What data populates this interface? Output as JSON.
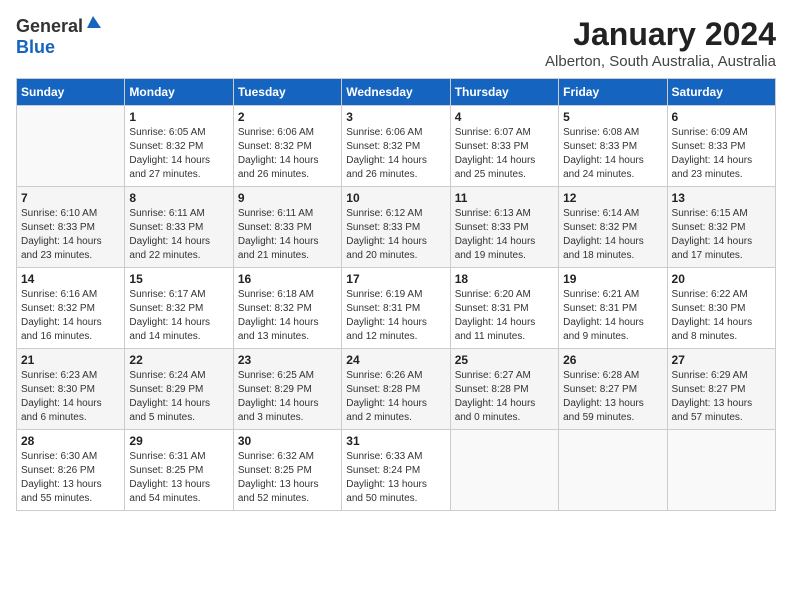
{
  "logo": {
    "general": "General",
    "blue": "Blue"
  },
  "title": "January 2024",
  "location": "Alberton, South Australia, Australia",
  "weekdays": [
    "Sunday",
    "Monday",
    "Tuesday",
    "Wednesday",
    "Thursday",
    "Friday",
    "Saturday"
  ],
  "weeks": [
    [
      {
        "day": "",
        "sunrise": "",
        "sunset": "",
        "daylight": ""
      },
      {
        "day": "1",
        "sunrise": "Sunrise: 6:05 AM",
        "sunset": "Sunset: 8:32 PM",
        "daylight": "Daylight: 14 hours and 27 minutes."
      },
      {
        "day": "2",
        "sunrise": "Sunrise: 6:06 AM",
        "sunset": "Sunset: 8:32 PM",
        "daylight": "Daylight: 14 hours and 26 minutes."
      },
      {
        "day": "3",
        "sunrise": "Sunrise: 6:06 AM",
        "sunset": "Sunset: 8:32 PM",
        "daylight": "Daylight: 14 hours and 26 minutes."
      },
      {
        "day": "4",
        "sunrise": "Sunrise: 6:07 AM",
        "sunset": "Sunset: 8:33 PM",
        "daylight": "Daylight: 14 hours and 25 minutes."
      },
      {
        "day": "5",
        "sunrise": "Sunrise: 6:08 AM",
        "sunset": "Sunset: 8:33 PM",
        "daylight": "Daylight: 14 hours and 24 minutes."
      },
      {
        "day": "6",
        "sunrise": "Sunrise: 6:09 AM",
        "sunset": "Sunset: 8:33 PM",
        "daylight": "Daylight: 14 hours and 23 minutes."
      }
    ],
    [
      {
        "day": "7",
        "sunrise": "Sunrise: 6:10 AM",
        "sunset": "Sunset: 8:33 PM",
        "daylight": "Daylight: 14 hours and 23 minutes."
      },
      {
        "day": "8",
        "sunrise": "Sunrise: 6:11 AM",
        "sunset": "Sunset: 8:33 PM",
        "daylight": "Daylight: 14 hours and 22 minutes."
      },
      {
        "day": "9",
        "sunrise": "Sunrise: 6:11 AM",
        "sunset": "Sunset: 8:33 PM",
        "daylight": "Daylight: 14 hours and 21 minutes."
      },
      {
        "day": "10",
        "sunrise": "Sunrise: 6:12 AM",
        "sunset": "Sunset: 8:33 PM",
        "daylight": "Daylight: 14 hours and 20 minutes."
      },
      {
        "day": "11",
        "sunrise": "Sunrise: 6:13 AM",
        "sunset": "Sunset: 8:33 PM",
        "daylight": "Daylight: 14 hours and 19 minutes."
      },
      {
        "day": "12",
        "sunrise": "Sunrise: 6:14 AM",
        "sunset": "Sunset: 8:32 PM",
        "daylight": "Daylight: 14 hours and 18 minutes."
      },
      {
        "day": "13",
        "sunrise": "Sunrise: 6:15 AM",
        "sunset": "Sunset: 8:32 PM",
        "daylight": "Daylight: 14 hours and 17 minutes."
      }
    ],
    [
      {
        "day": "14",
        "sunrise": "Sunrise: 6:16 AM",
        "sunset": "Sunset: 8:32 PM",
        "daylight": "Daylight: 14 hours and 16 minutes."
      },
      {
        "day": "15",
        "sunrise": "Sunrise: 6:17 AM",
        "sunset": "Sunset: 8:32 PM",
        "daylight": "Daylight: 14 hours and 14 minutes."
      },
      {
        "day": "16",
        "sunrise": "Sunrise: 6:18 AM",
        "sunset": "Sunset: 8:32 PM",
        "daylight": "Daylight: 14 hours and 13 minutes."
      },
      {
        "day": "17",
        "sunrise": "Sunrise: 6:19 AM",
        "sunset": "Sunset: 8:31 PM",
        "daylight": "Daylight: 14 hours and 12 minutes."
      },
      {
        "day": "18",
        "sunrise": "Sunrise: 6:20 AM",
        "sunset": "Sunset: 8:31 PM",
        "daylight": "Daylight: 14 hours and 11 minutes."
      },
      {
        "day": "19",
        "sunrise": "Sunrise: 6:21 AM",
        "sunset": "Sunset: 8:31 PM",
        "daylight": "Daylight: 14 hours and 9 minutes."
      },
      {
        "day": "20",
        "sunrise": "Sunrise: 6:22 AM",
        "sunset": "Sunset: 8:30 PM",
        "daylight": "Daylight: 14 hours and 8 minutes."
      }
    ],
    [
      {
        "day": "21",
        "sunrise": "Sunrise: 6:23 AM",
        "sunset": "Sunset: 8:30 PM",
        "daylight": "Daylight: 14 hours and 6 minutes."
      },
      {
        "day": "22",
        "sunrise": "Sunrise: 6:24 AM",
        "sunset": "Sunset: 8:29 PM",
        "daylight": "Daylight: 14 hours and 5 minutes."
      },
      {
        "day": "23",
        "sunrise": "Sunrise: 6:25 AM",
        "sunset": "Sunset: 8:29 PM",
        "daylight": "Daylight: 14 hours and 3 minutes."
      },
      {
        "day": "24",
        "sunrise": "Sunrise: 6:26 AM",
        "sunset": "Sunset: 8:28 PM",
        "daylight": "Daylight: 14 hours and 2 minutes."
      },
      {
        "day": "25",
        "sunrise": "Sunrise: 6:27 AM",
        "sunset": "Sunset: 8:28 PM",
        "daylight": "Daylight: 14 hours and 0 minutes."
      },
      {
        "day": "26",
        "sunrise": "Sunrise: 6:28 AM",
        "sunset": "Sunset: 8:27 PM",
        "daylight": "Daylight: 13 hours and 59 minutes."
      },
      {
        "day": "27",
        "sunrise": "Sunrise: 6:29 AM",
        "sunset": "Sunset: 8:27 PM",
        "daylight": "Daylight: 13 hours and 57 minutes."
      }
    ],
    [
      {
        "day": "28",
        "sunrise": "Sunrise: 6:30 AM",
        "sunset": "Sunset: 8:26 PM",
        "daylight": "Daylight: 13 hours and 55 minutes."
      },
      {
        "day": "29",
        "sunrise": "Sunrise: 6:31 AM",
        "sunset": "Sunset: 8:25 PM",
        "daylight": "Daylight: 13 hours and 54 minutes."
      },
      {
        "day": "30",
        "sunrise": "Sunrise: 6:32 AM",
        "sunset": "Sunset: 8:25 PM",
        "daylight": "Daylight: 13 hours and 52 minutes."
      },
      {
        "day": "31",
        "sunrise": "Sunrise: 6:33 AM",
        "sunset": "Sunset: 8:24 PM",
        "daylight": "Daylight: 13 hours and 50 minutes."
      },
      {
        "day": "",
        "sunrise": "",
        "sunset": "",
        "daylight": ""
      },
      {
        "day": "",
        "sunrise": "",
        "sunset": "",
        "daylight": ""
      },
      {
        "day": "",
        "sunrise": "",
        "sunset": "",
        "daylight": ""
      }
    ]
  ]
}
